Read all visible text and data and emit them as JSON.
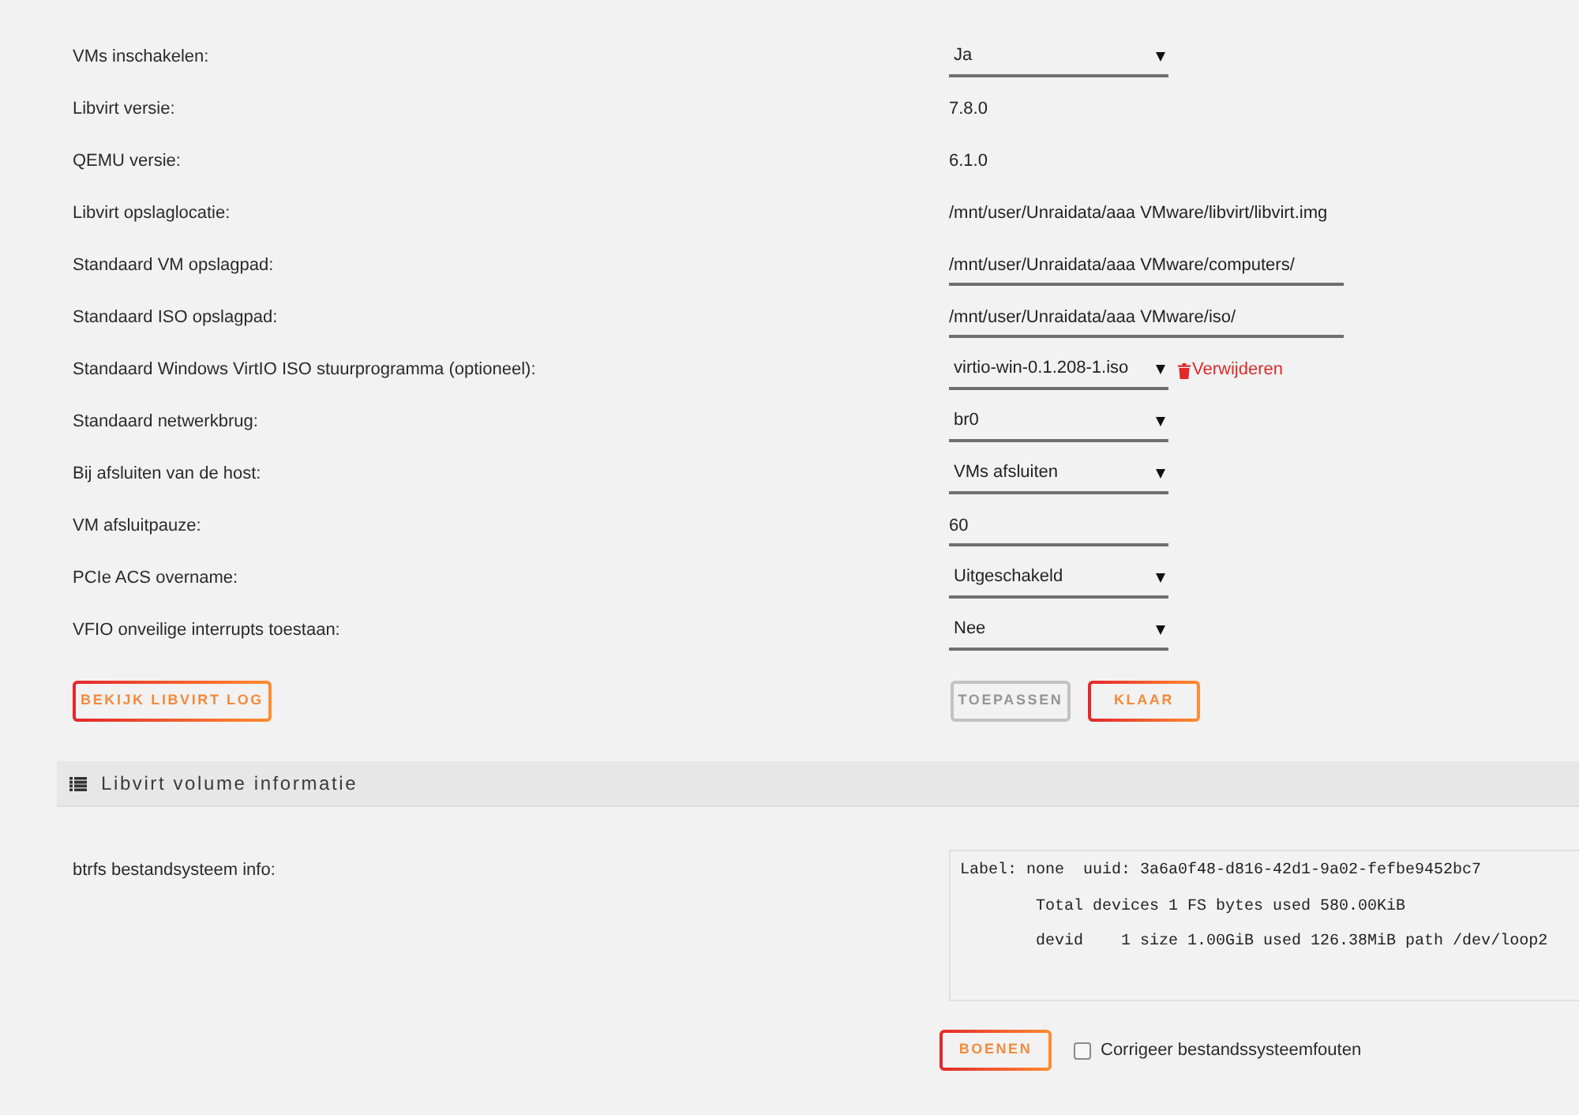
{
  "settings": [
    {
      "label": "VMs inschakelen:",
      "kind": "select",
      "value": "Ja"
    },
    {
      "label": "Libvirt versie:",
      "kind": "text",
      "value": "7.8.0"
    },
    {
      "label": "QEMU versie:",
      "kind": "text",
      "value": "6.1.0"
    },
    {
      "label": "Libvirt opslaglocatie:",
      "kind": "text",
      "value": "/mnt/user/Unraidata/aaa VMware/libvirt/libvirt.img"
    },
    {
      "label": "Standaard VM opslagpad:",
      "kind": "input",
      "value": "/mnt/user/Unraidata/aaa VMware/computers/"
    },
    {
      "label": "Standaard ISO opslagpad:",
      "kind": "input",
      "value": "/mnt/user/Unraidata/aaa VMware/iso/"
    },
    {
      "label": "Standaard Windows VirtIO ISO stuurprogramma (optioneel):",
      "kind": "select",
      "value": "virtio-win-0.1.208-1.iso",
      "action": "Verwijderen"
    },
    {
      "label": "Standaard netwerkbrug:",
      "kind": "select",
      "value": "br0"
    },
    {
      "label": "Bij afsluiten van de host:",
      "kind": "select",
      "value": "VMs afsluiten"
    },
    {
      "label": "VM afsluitpauze:",
      "kind": "number",
      "value": "60"
    },
    {
      "label": "PCIe ACS overname:",
      "kind": "select",
      "value": "Uitgeschakeld"
    },
    {
      "label": "VFIO onveilige interrupts toestaan:",
      "kind": "select",
      "value": "Nee"
    }
  ],
  "log_button": "BEKIJK LIBVIRT LOG",
  "actions": [
    {
      "label": "TOEPASSEN",
      "disabled": true
    },
    {
      "label": "KLAAR",
      "disabled": false
    }
  ],
  "volume_section": {
    "title": "Libvirt volume informatie",
    "info_label": "btrfs bestandsysteem info:",
    "info_output": "Label: none  uuid: 3a6a0f48-d816-42d1-9a02-fefbe9452bc7\n\tTotal devices 1 FS bytes used 580.00KiB\n\tdevid    1 size 1.00GiB used 126.38MiB path /dev/loop2",
    "scrub_button": "BOENEN",
    "repair": {
      "label": "Corrigeer bestandssysteemfouten",
      "checked": false
    }
  }
}
